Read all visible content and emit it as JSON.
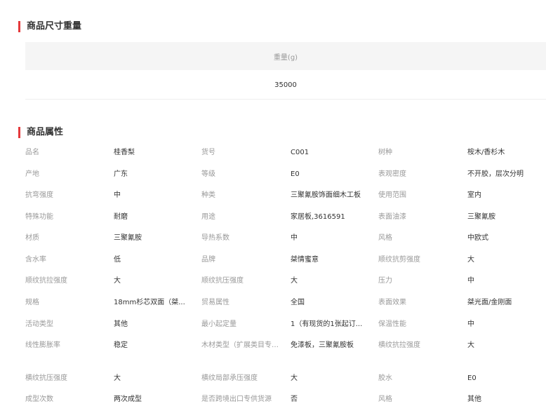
{
  "dimensions": {
    "title": "商品尺寸重量",
    "header": "重量(g)",
    "value": "35000"
  },
  "attributes": {
    "title": "商品属性",
    "rows": [
      [
        [
          "品名",
          "桂香梨"
        ],
        [
          "货号",
          "C001"
        ],
        [
          "树种",
          "桉木/香杉木"
        ]
      ],
      [
        [
          "产地",
          "广东"
        ],
        [
          "等级",
          "E0"
        ],
        [
          "表观密度",
          "不开胶，层次分明"
        ]
      ],
      [
        [
          "抗弯强度",
          "中"
        ],
        [
          "种类",
          "三聚氰胺饰面细木工板"
        ],
        [
          "使用范围",
          "室内"
        ]
      ],
      [
        [
          "特殊功能",
          "耐磨"
        ],
        [
          "用途",
          "家居板,3616591"
        ],
        [
          "表面油漆",
          "三聚氰胺"
        ]
      ],
      [
        [
          "材质",
          "三聚氰胺"
        ],
        [
          "导热系数",
          "中"
        ],
        [
          "风格",
          "中欧式"
        ]
      ],
      [
        [
          "含水率",
          "低"
        ],
        [
          "品牌",
          "桀情蜜意"
        ],
        [
          "顺纹抗剪强度",
          "大"
        ]
      ],
      [
        [
          "顺纹抗拉强度",
          "大"
        ],
        [
          "顺纹抗压强度",
          "大"
        ],
        [
          "压力",
          "中"
        ]
      ],
      [
        [
          "规格",
          "18mm杉芯双面（桀..."
        ],
        [
          "贸易属性",
          "全国"
        ],
        [
          "表面效果",
          "桀光面/金刚面"
        ]
      ],
      [
        [
          "活动类型",
          "其他"
        ],
        [
          "最小起定量",
          "1（有现货的1张起订..."
        ],
        [
          "保温性能",
          "中"
        ]
      ],
      [
        [
          "线性膨胀率",
          "稳定"
        ],
        [
          "木材类型（扩展类目专用）",
          "免漆板，三聚氰胺板"
        ],
        [
          "横纹抗拉强度",
          "大"
        ]
      ],
      [
        [
          "横纹抗压强度",
          "大"
        ],
        [
          "横纹局部承压强度",
          "大"
        ],
        [
          "胶水",
          "E0"
        ]
      ],
      [
        [
          "成型次数",
          "两次成型"
        ],
        [
          "是否跨境出口专供货源",
          "否"
        ],
        [
          "风格",
          "其他"
        ]
      ]
    ]
  }
}
